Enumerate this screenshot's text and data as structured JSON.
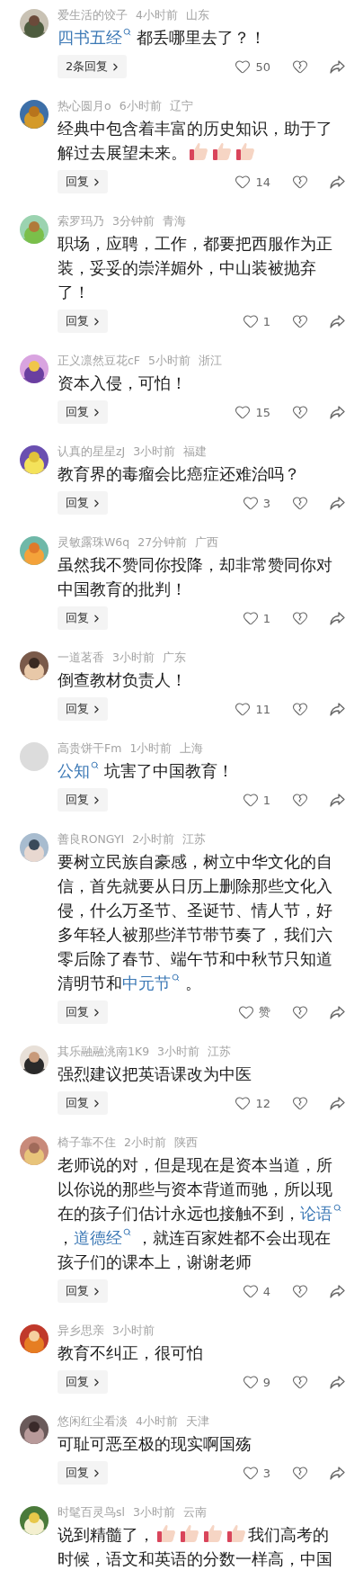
{
  "comments": [
    {
      "avatar": {
        "kind": "picture"
      },
      "name": "爱生活的饺子",
      "time": "4小时前",
      "location": "山东",
      "body": [
        {
          "kind": "link",
          "text": "四书五经"
        },
        {
          "kind": "text",
          "text": " 都丢哪里去了？！"
        }
      ],
      "reply": "2条回复",
      "likes": "50"
    },
    {
      "avatar": {
        "kind": "picture"
      },
      "name": "热心圆月o",
      "time": "6小时前",
      "location": "辽宁",
      "body": [
        {
          "kind": "text",
          "text": "经典中包含着丰富的历史知识，助于了解过去展望未来。"
        },
        {
          "kind": "thumb"
        },
        {
          "kind": "thumb"
        },
        {
          "kind": "thumb"
        }
      ],
      "reply": "回复",
      "likes": "14"
    },
    {
      "avatar": {
        "kind": "picture"
      },
      "name": "索罗玛乃",
      "time": "3分钟前",
      "location": "青海",
      "body": [
        {
          "kind": "text",
          "text": "职场，应聘，工作，都要把西服作为正装，妥妥的崇洋媚外，中山装被抛弃了！"
        }
      ],
      "reply": "回复",
      "likes": "1"
    },
    {
      "avatar": {
        "kind": "picture"
      },
      "name": "正义凛然豆花cF",
      "time": "5小时前",
      "location": "浙江",
      "body": [
        {
          "kind": "text",
          "text": "资本入侵，可怕！"
        }
      ],
      "reply": "回复",
      "likes": "15"
    },
    {
      "avatar": {
        "kind": "picture"
      },
      "name": "认真的星星zJ",
      "time": "3小时前",
      "location": "福建",
      "body": [
        {
          "kind": "text",
          "text": "教育界的毒瘤会比癌症还难治吗？"
        }
      ],
      "reply": "回复",
      "likes": "3"
    },
    {
      "avatar": {
        "kind": "picture"
      },
      "name": "灵敏露珠W6q",
      "time": "27分钟前",
      "location": "广西",
      "body": [
        {
          "kind": "text",
          "text": "虽然我不赞同你投降，却非常赞同你对中国教育的批判！"
        }
      ],
      "reply": "回复",
      "likes": "1"
    },
    {
      "avatar": {
        "kind": "picture"
      },
      "name": "一道茗香",
      "time": "3小时前",
      "location": "广东",
      "body": [
        {
          "kind": "text",
          "text": "倒查教材负责人！"
        }
      ],
      "reply": "回复",
      "likes": "11"
    },
    {
      "avatar": {
        "kind": "blank"
      },
      "name": "高贵饼干Fm",
      "time": "1小时前",
      "location": "上海",
      "body": [
        {
          "kind": "link",
          "text": "公知"
        },
        {
          "kind": "text",
          "text": " 坑害了中国教育！"
        }
      ],
      "reply": "回复",
      "likes": "1"
    },
    {
      "avatar": {
        "kind": "picture"
      },
      "name": "善良RONGYI",
      "time": "2小时前",
      "location": "江苏",
      "body": [
        {
          "kind": "text",
          "text": "要树立民族自豪感，树立中华文化的自信，首先就要从日历上删除那些文化入侵，什么万圣节、圣诞节、情人节，好多年轻人被那些洋节带节奏了，我们六零后除了春节、端午节和中秋节只知道清明节和"
        },
        {
          "kind": "link",
          "text": "中元节"
        },
        {
          "kind": "text",
          "text": " 。"
        }
      ],
      "reply": "回复",
      "likes": "赞"
    },
    {
      "avatar": {
        "kind": "picture"
      },
      "name": "其乐融融洮南1K9",
      "time": "3小时前",
      "location": "江苏",
      "body": [
        {
          "kind": "text",
          "text": "强烈建议把英语课改为中医"
        }
      ],
      "reply": "回复",
      "likes": "12"
    },
    {
      "avatar": {
        "kind": "picture"
      },
      "name": "椅子靠不住",
      "time": "2小时前",
      "location": "陕西",
      "body": [
        {
          "kind": "text",
          "text": "老师说的对，但是现在是资本当道，所以你说的那些与资本背道而驰，所以现在的孩子们估计永远也接触不到，"
        },
        {
          "kind": "link",
          "text": "论语"
        },
        {
          "kind": "text",
          "text": " ，"
        },
        {
          "kind": "link",
          "text": "道德经"
        },
        {
          "kind": "text",
          "text": " ，就连百家姓都不会出现在孩子们的课本上，谢谢老师"
        }
      ],
      "reply": "回复",
      "likes": "4"
    },
    {
      "avatar": {
        "kind": "picture"
      },
      "name": "异乡思亲",
      "time": "3小时前",
      "body": [
        {
          "kind": "text",
          "text": "教育不纠正，很可怕"
        }
      ],
      "reply": "回复",
      "likes": "9"
    },
    {
      "avatar": {
        "kind": "picture"
      },
      "name": "悠闲红尘看淡",
      "time": "4小时前",
      "location": "天津",
      "body": [
        {
          "kind": "text",
          "text": "可耻可恶至极的现实啊国殇"
        }
      ],
      "reply": "回复",
      "likes": "3"
    },
    {
      "avatar": {
        "kind": "picture"
      },
      "name": "时髦百灵鸟sl",
      "time": "3小时前",
      "location": "云南",
      "body": [
        {
          "kind": "text",
          "text": "说到精髓了，"
        },
        {
          "kind": "thumb"
        },
        {
          "kind": "thumb"
        },
        {
          "kind": "thumb"
        },
        {
          "kind": "thumb"
        },
        {
          "kind": "text",
          "text": "我们高考的时候，语文和英语的分数一样高，中国"
        }
      ]
    }
  ]
}
